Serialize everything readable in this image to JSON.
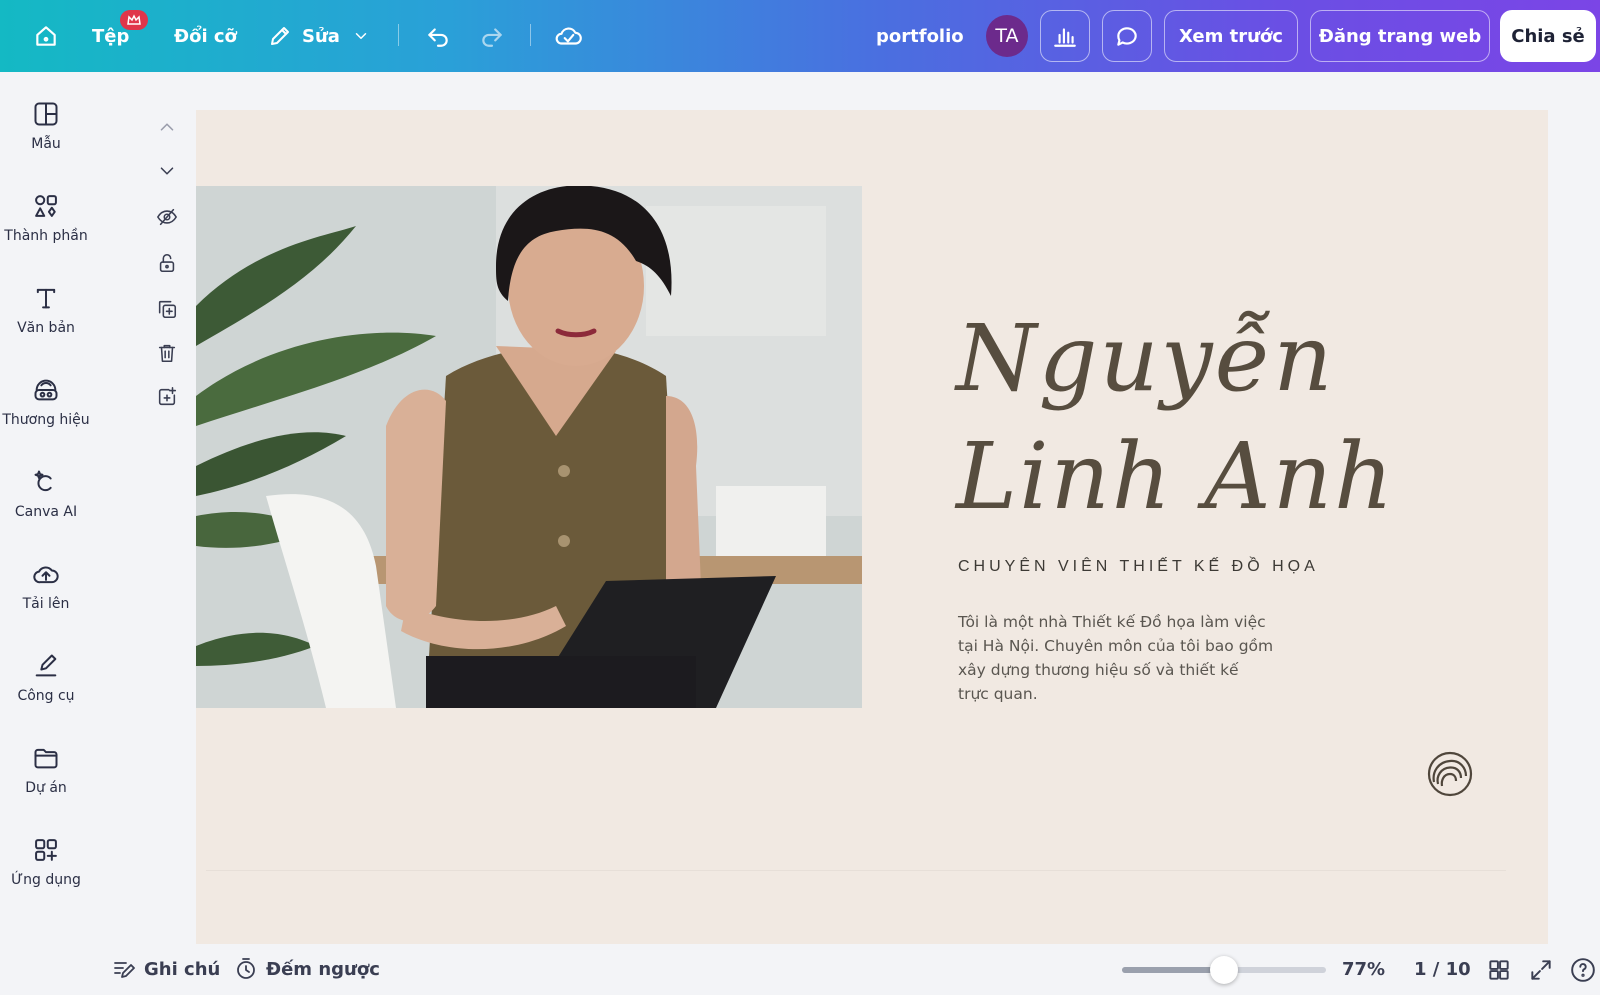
{
  "topbar": {
    "file_label": "Tệp",
    "resize_label": "Đổi cỡ",
    "edit_label": "Sửa",
    "doc_title": "portfolio",
    "avatar_initials": "TA",
    "preview_label": "Xem trước",
    "publish_label": "Đăng trang web",
    "share_label": "Chia sẻ"
  },
  "sidebar": {
    "items": [
      {
        "label": "Mẫu",
        "icon": "template-icon"
      },
      {
        "label": "Thành phần",
        "icon": "elements-icon"
      },
      {
        "label": "Văn bản",
        "icon": "text-icon"
      },
      {
        "label": "Thương hiệu",
        "icon": "brand-icon"
      },
      {
        "label": "Canva AI",
        "icon": "canva-ai-icon"
      },
      {
        "label": "Tải lên",
        "icon": "upload-icon"
      },
      {
        "label": "Công cụ",
        "icon": "tools-icon"
      },
      {
        "label": "Dự án",
        "icon": "folder-icon"
      },
      {
        "label": "Ứng dụng",
        "icon": "apps-icon"
      }
    ]
  },
  "canvas": {
    "name_line1": "Nguyễn",
    "name_line2": "Linh Anh",
    "role": "CHUYÊN VIÊN THIẾT KẾ ĐỒ HỌA",
    "bio_lines": [
      "Tôi là một nhà Thiết kế Đồ họa làm việc",
      "tại Hà Nội. Chuyên môn của tôi bao gồm",
      "xây dựng thương hiệu số và thiết kế",
      "trực quan."
    ]
  },
  "bottombar": {
    "notes_label": "Ghi chú",
    "timer_label": "Đếm ngược",
    "zoom_value": 0.5,
    "zoom_label": "77%",
    "page_label": "1 / 10"
  },
  "colors": {
    "topbar_start": "#14b9c4",
    "topbar_end": "#7b45e6",
    "canvas_bg": "#f1e9e2",
    "name_color": "#574d3f",
    "badge": "#e0364a"
  }
}
